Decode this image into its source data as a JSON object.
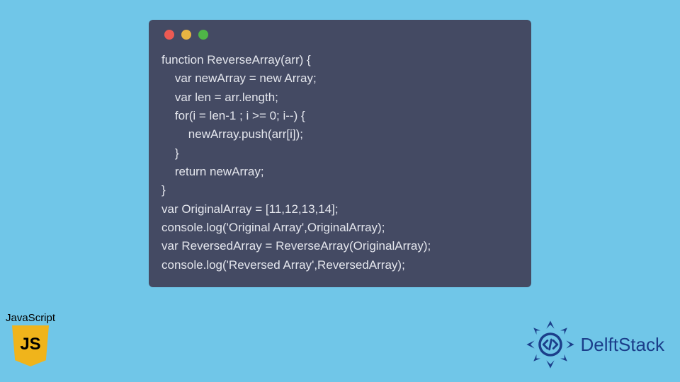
{
  "code_window": {
    "lines": [
      "function ReverseArray(arr) {",
      "    var newArray = new Array;",
      "    var len = arr.length;",
      "    for(i = len-1 ; i >= 0; i--) {",
      "        newArray.push(arr[i]);",
      "    }",
      "    return newArray;",
      "}",
      "var OriginalArray = [11,12,13,14];",
      "console.log('Original Array',OriginalArray);",
      "var ReversedArray = ReverseArray(OriginalArray);",
      "console.log('Reversed Array',ReversedArray);"
    ]
  },
  "js_badge": {
    "label": "JavaScript",
    "shield_text": "JS"
  },
  "brand": {
    "name": "DelftStack"
  },
  "colors": {
    "page_bg": "#70c6e8",
    "window_bg": "#444a63",
    "code_text": "#e4e6ed",
    "js_yellow": "#f0b41b",
    "brand_blue": "#1b3e8a"
  }
}
